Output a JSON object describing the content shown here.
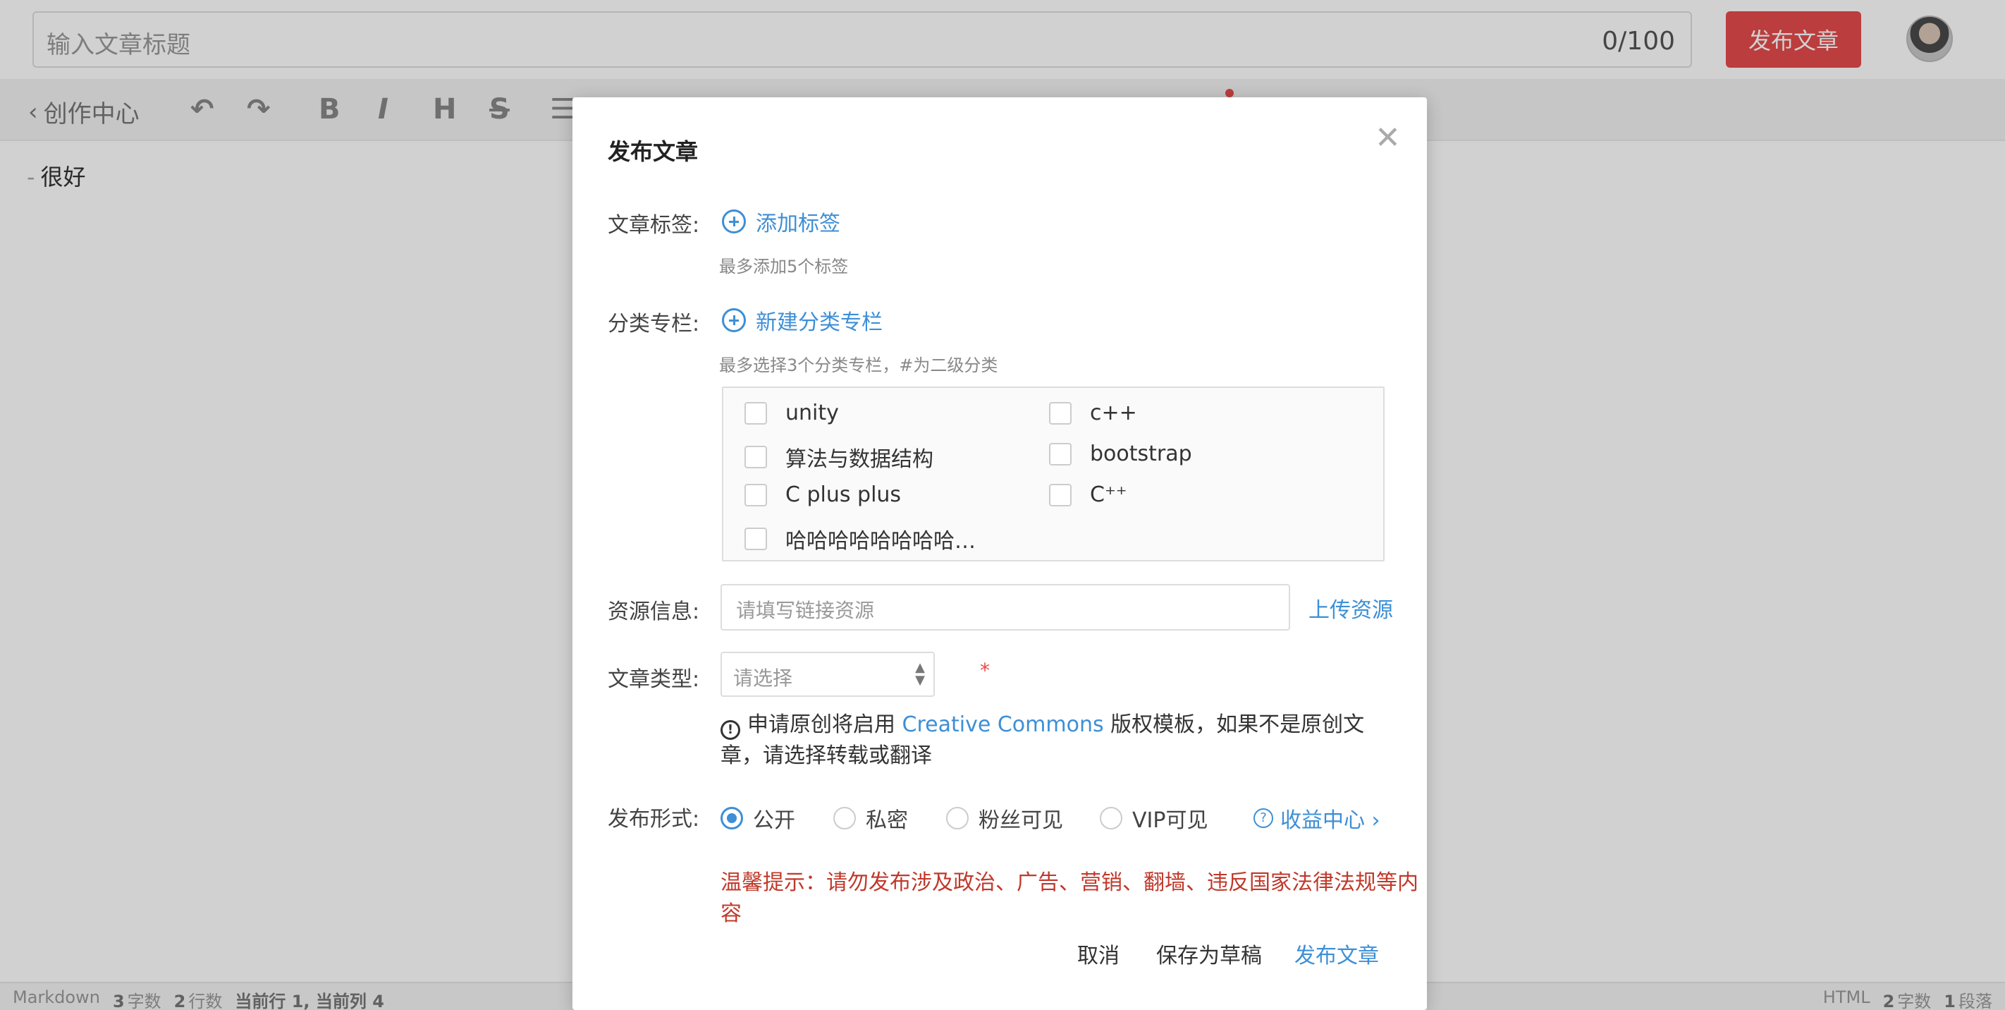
{
  "header": {
    "title_placeholder": "输入文章标题",
    "title_counter": "0/100",
    "publish_label": "发布文章"
  },
  "toolbar": {
    "back_label": "创作中心",
    "icons": [
      "undo-icon",
      "redo-icon",
      "bold-icon",
      "italic-icon",
      "heading-icon",
      "strikethrough-icon",
      "list-icon"
    ]
  },
  "editor": {
    "content": "很好"
  },
  "statusbar": {
    "mode": "Markdown",
    "chars_count": "3",
    "chars_label": "字数",
    "lines_count": "2",
    "lines_label": "行数",
    "cursor": "当前行 1, 当前列 4",
    "right_mode": "HTML",
    "right_chars_count": "2",
    "right_chars_label": "字数",
    "right_paragraph_count": "1",
    "right_paragraph_label": "段落"
  },
  "modal": {
    "title": "发布文章",
    "tags": {
      "label": "文章标签:",
      "add_label": "添加标签",
      "hint": "最多添加5个标签"
    },
    "category": {
      "label": "分类专栏:",
      "add_label": "新建分类专栏",
      "hint": "最多选择3个分类专栏，#为二级分类",
      "items": [
        "unity",
        "c++",
        "算法与数据结构",
        "bootstrap",
        "C plus plus",
        "C⁺⁺",
        "哈哈哈哈哈哈哈哈…"
      ]
    },
    "resource": {
      "label": "资源信息:",
      "placeholder": "请填写链接资源",
      "upload_label": "上传资源"
    },
    "type": {
      "label": "文章类型:",
      "placeholder": "请选择",
      "required": "*"
    },
    "notice": {
      "before": "申请原创将启用",
      "link": "Creative Commons",
      "after": "版权模板，如果不是原创文章，请选择转载或翻译"
    },
    "visibility": {
      "label": "发布形式:",
      "options": [
        "公开",
        "私密",
        "粉丝可见",
        "VIP可见"
      ],
      "selected": "公开",
      "income_label": "收益中心 ›"
    },
    "warning": "温馨提示：请勿发布涉及政治、广告、营销、翻墙、违反国家法律法规等内容",
    "buttons": {
      "cancel": "取消",
      "draft": "保存为草稿",
      "publish": "发布文章"
    }
  },
  "colors": {
    "accent": "#3d8fd6",
    "brand_red": "#e64b4b",
    "warning_red": "#c0392b"
  }
}
